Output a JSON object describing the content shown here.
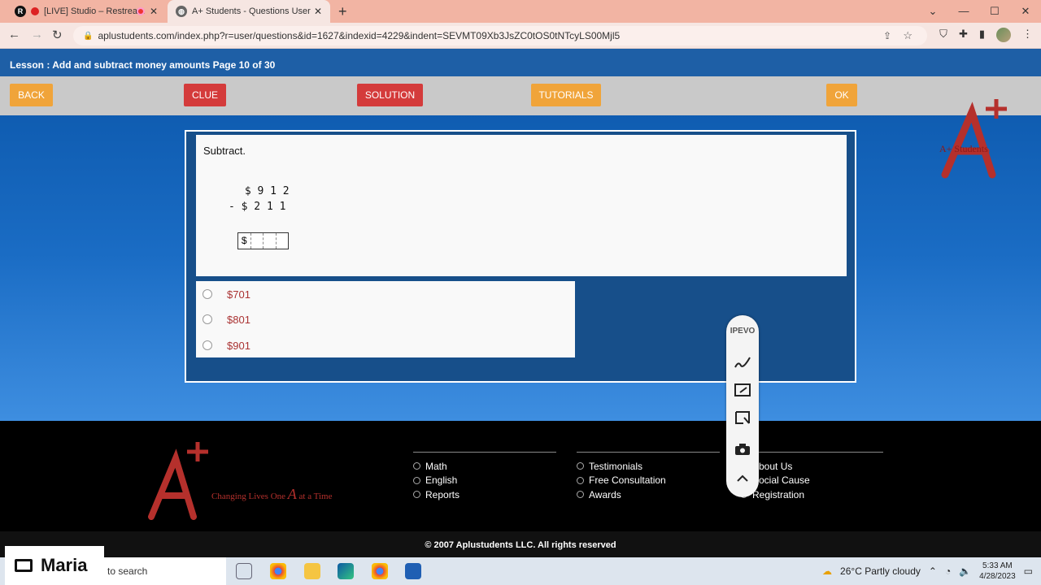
{
  "browser": {
    "tabs": [
      {
        "title": "[LIVE] Studio – Restream",
        "icon": "restream-icon"
      },
      {
        "title": "A+ Students - Questions User",
        "icon": "globe-icon"
      }
    ],
    "url": "aplustudents.com/index.php?r=user/questions&id=1627&indexid=4229&indent=SEVMT09Xb3JsZC0tOS0tNTcyLS00Mjl5"
  },
  "lesson": {
    "title": "Lesson : Add and subtract money amounts Page 10 of 30"
  },
  "toolbar": {
    "back": "BACK",
    "clue": "CLUE",
    "solution": "SOLUTION",
    "tutorials": "TUTORIALS",
    "ok": "OK"
  },
  "brand": {
    "caption": "A+ Students",
    "tagline_pre": "Changing Lives One",
    "tagline_a": "A",
    "tagline_post": "at a Time",
    "colors": {
      "brand_red": "#b5302c",
      "page_blue": "#1a6cc4"
    }
  },
  "question": {
    "instruction": "Subtract.",
    "line1": " $ 9 1 2",
    "line2": "- $ 2 1 1",
    "answer_prefix": "$"
  },
  "choices": [
    "$701",
    "$801",
    "$901"
  ],
  "ipevo": {
    "label": "IPEVO"
  },
  "footer": {
    "col1": [
      "Math",
      "English",
      "Reports"
    ],
    "col2": [
      "Testimonials",
      "Free Consultation",
      "Awards"
    ],
    "col3": [
      "About Us",
      "Social Cause",
      "Registration"
    ],
    "copyright": "© 2007 Aplustudents LLC. All rights reserved"
  },
  "taskbar": {
    "search": "to search",
    "weather": "26°C  Partly cloudy",
    "time": "5:33 AM",
    "date": "4/28/2023"
  },
  "overlay": {
    "name": "Maria"
  }
}
